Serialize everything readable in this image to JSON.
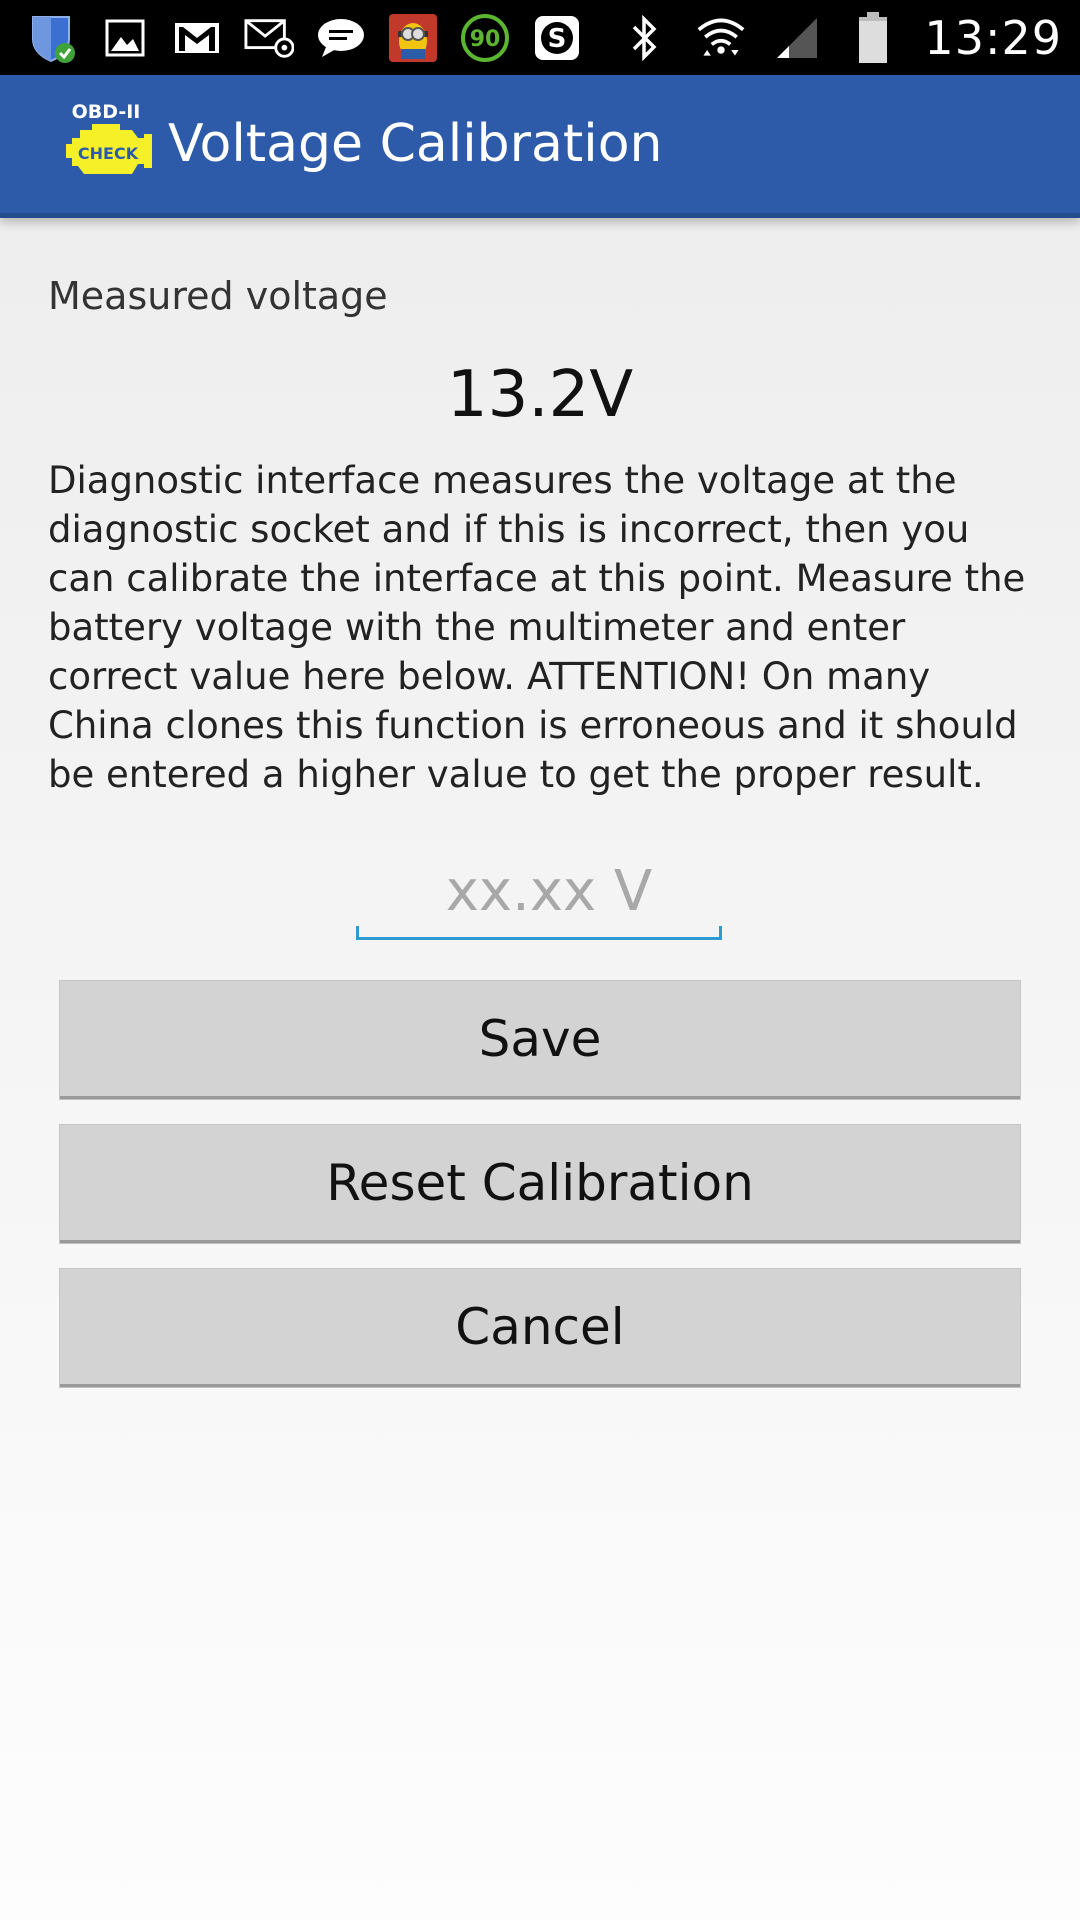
{
  "status_bar": {
    "time": "13:29",
    "notification_icons": [
      "shield-check-icon",
      "image-icon",
      "gmail-icon",
      "email-icon",
      "chat-bubble-icon",
      "minion-app-icon",
      "speed-90-icon",
      "skype-icon"
    ],
    "speed_badge": "90",
    "skype_badge": "S",
    "system_icons": [
      "bluetooth-icon",
      "wifi-icon",
      "signal-icon",
      "battery-icon"
    ]
  },
  "app_bar": {
    "logo_top_text": "OBD-II",
    "logo_badge_text": "CHECK",
    "title": "Voltage Calibration",
    "color": "#2d5ba9"
  },
  "main": {
    "measured_label": "Measured voltage",
    "measured_value": "13.2V",
    "description": "Diagnostic interface measures the voltage at the diagnostic socket and if this is incorrect, then you can calibrate the interface at this point. Measure the battery voltage with the multimeter and enter correct value here below. ATTENTION! On many China clones this function is erroneous and it should be entered a higher value to get the proper result.",
    "voltage_input": {
      "value": "",
      "placeholder": "xx.xx V"
    },
    "buttons": {
      "save": "Save",
      "reset": "Reset Calibration",
      "cancel": "Cancel"
    },
    "accent_color": "#2e9bd0"
  }
}
